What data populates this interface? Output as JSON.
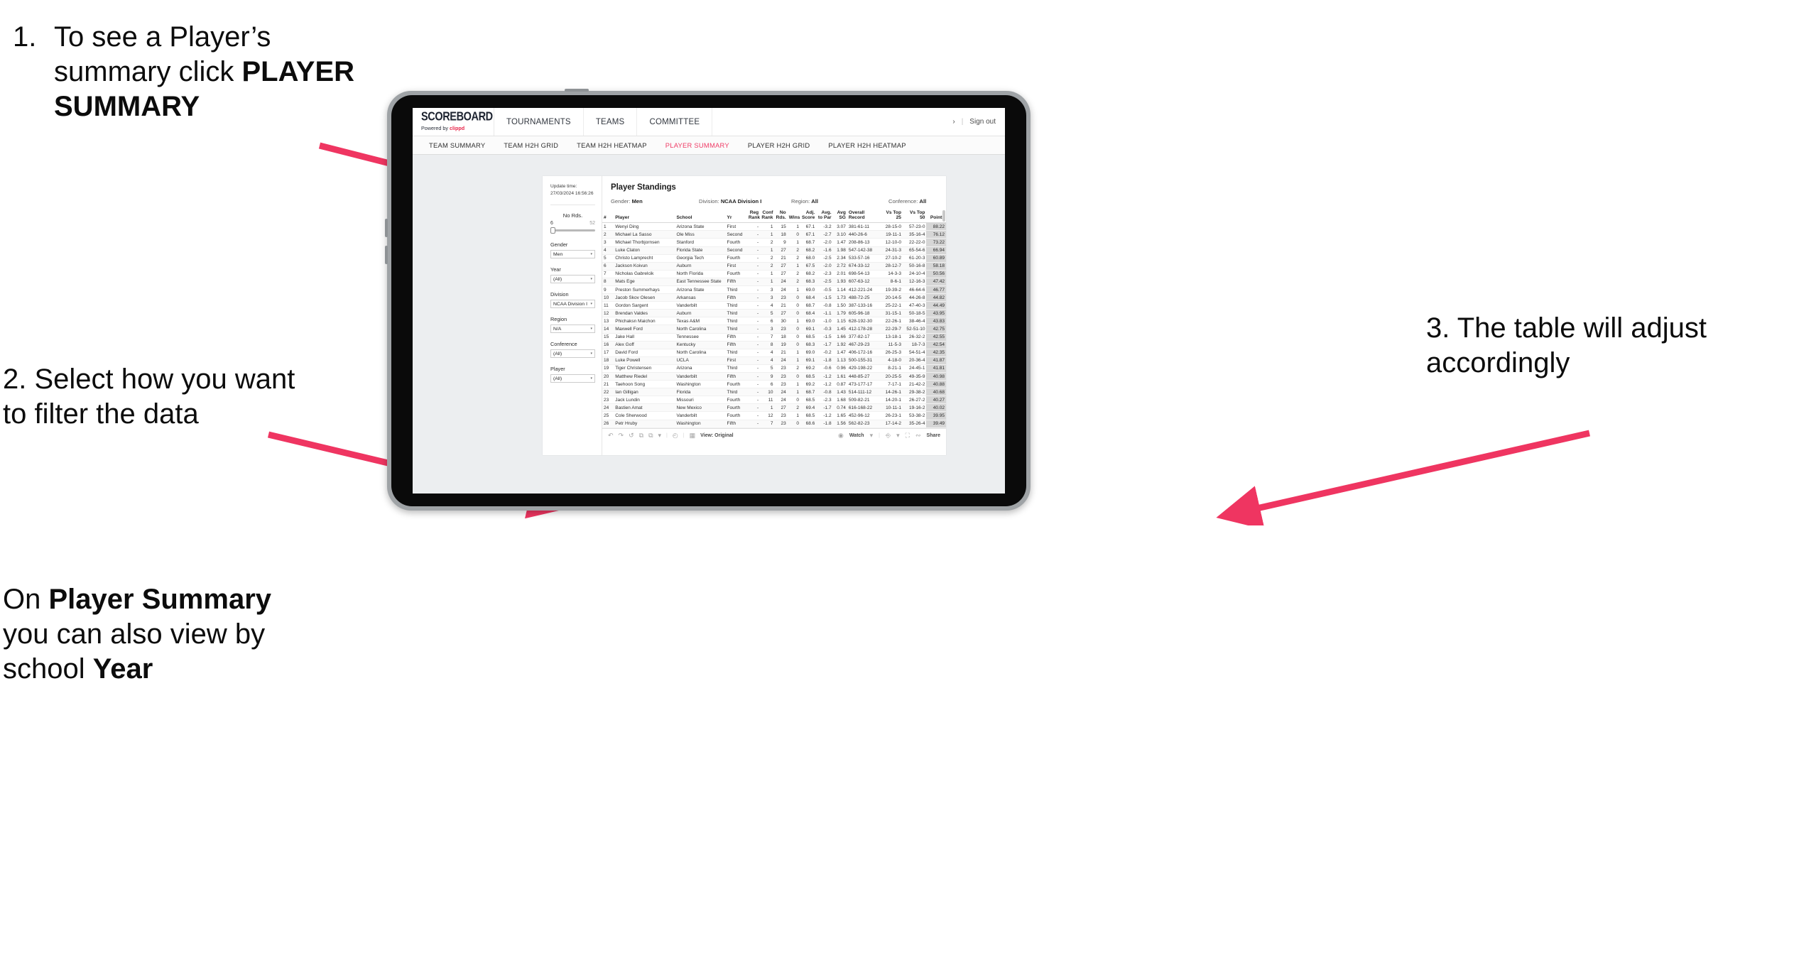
{
  "annotations": {
    "step1": {
      "number": "1.",
      "text_before": "To see a Player’s summary click ",
      "bold": "PLAYER SUMMARY"
    },
    "step2": {
      "number": "2.",
      "text": "Select how you want to filter the data"
    },
    "step2b": {
      "p1": "On ",
      "b1": "Player Summary",
      "p2": " you can also view by school ",
      "b2": "Year"
    },
    "step3": {
      "number": "3.",
      "text": "The table will adjust accordingly"
    }
  },
  "app": {
    "logo_main": "SCOREBOARD",
    "logo_sub_prefix": "Powered by ",
    "logo_sub_brand": "clippd",
    "main_nav": [
      "TOURNAMENTS",
      "TEAMS",
      "COMMITTEE"
    ],
    "account_glyph": "›",
    "sep": "|",
    "sign_out": "Sign out",
    "sub_nav": [
      "TEAM SUMMARY",
      "TEAM H2H GRID",
      "TEAM H2H HEATMAP",
      "PLAYER SUMMARY",
      "PLAYER H2H GRID",
      "PLAYER H2H HEATMAP"
    ],
    "sub_nav_active": "PLAYER SUMMARY",
    "accent_color": "#ef3c66"
  },
  "filters": {
    "update_label": "Update time:",
    "update_value": "27/03/2024 16:56:26",
    "slider": {
      "title": "No Rds.",
      "min": "6",
      "max": "52"
    },
    "selects": [
      {
        "label": "Gender",
        "value": "Men"
      },
      {
        "label": "Year",
        "value": "(All)"
      },
      {
        "label": "Division",
        "value": "NCAA Division I"
      },
      {
        "label": "Region",
        "value": "N/A"
      },
      {
        "label": "Conference",
        "value": "(All)"
      },
      {
        "label": "Player",
        "value": "(All)"
      }
    ]
  },
  "viz": {
    "title": "Player Standings",
    "meta": [
      {
        "label": "Gender: ",
        "value": "Men"
      },
      {
        "label": "Division: ",
        "value": "NCAA Division I"
      },
      {
        "label": "Region: ",
        "value": "All"
      },
      {
        "label": "Conference: ",
        "value": "All"
      }
    ]
  },
  "toolbar": {
    "undo": "↶",
    "redo": "↷",
    "revert": "↺",
    "refresh": "⧉",
    "pause": "⧉",
    "view_caret": "▾",
    "clock": "◴",
    "view_label": "View: Original",
    "watch_label": "Watch",
    "watch_caret": "▾",
    "download_caret": "▾",
    "fullscreen": "⛶",
    "share_label": "Share"
  },
  "table": {
    "columns": [
      "#",
      "Player",
      "School",
      "Yr",
      "Reg Rank",
      "Conf Rank",
      "No Rds.",
      "Wins",
      "Adj. Score",
      "Avg. to Par",
      "Avg SG",
      "Overall Record",
      "Vs Top 25",
      "Vs Top 50",
      "Points"
    ],
    "rows": [
      [
        "1",
        "Wenyi Ding",
        "Arizona State",
        "First",
        "-",
        "1",
        "15",
        "1",
        "67.1",
        "-3.2",
        "3.07",
        "381-61-11",
        "28-15-0",
        "57-23-0",
        "88.22"
      ],
      [
        "2",
        "Michael La Sasso",
        "Ole Miss",
        "Second",
        "-",
        "1",
        "18",
        "0",
        "67.1",
        "-2.7",
        "3.10",
        "440-26-6",
        "19-11-1",
        "35-16-4",
        "76.12"
      ],
      [
        "3",
        "Michael Thorbjornsen",
        "Stanford",
        "Fourth",
        "-",
        "2",
        "9",
        "1",
        "68.7",
        "-2.0",
        "1.47",
        "208-86-13",
        "12-10-0",
        "22-22-0",
        "73.22"
      ],
      [
        "4",
        "Luke Claton",
        "Florida State",
        "Second",
        "-",
        "1",
        "27",
        "2",
        "68.2",
        "-1.6",
        "1.98",
        "547-142-38",
        "24-31-3",
        "65-54-6",
        "66.94"
      ],
      [
        "5",
        "Christo Lamprecht",
        "Georgia Tech",
        "Fourth",
        "-",
        "2",
        "21",
        "2",
        "68.0",
        "-2.5",
        "2.34",
        "533-57-16",
        "27-10-2",
        "61-20-3",
        "60.89"
      ],
      [
        "6",
        "Jackson Koivun",
        "Auburn",
        "First",
        "-",
        "2",
        "27",
        "1",
        "67.5",
        "-2.0",
        "2.72",
        "674-33-12",
        "28-12-7",
        "50-16-8",
        "58.18"
      ],
      [
        "7",
        "Nicholas Gabrelcik",
        "North Florida",
        "Fourth",
        "-",
        "1",
        "27",
        "2",
        "68.2",
        "-2.3",
        "2.01",
        "698-54-13",
        "14-3-3",
        "24-10-4",
        "50.56"
      ],
      [
        "8",
        "Mats Ege",
        "East Tennessee State",
        "Fifth",
        "-",
        "1",
        "24",
        "2",
        "68.3",
        "-2.5",
        "1.93",
        "607-63-12",
        "8-6-1",
        "12-16-3",
        "47.42"
      ],
      [
        "9",
        "Preston Summerhays",
        "Arizona State",
        "Third",
        "-",
        "3",
        "24",
        "1",
        "69.0",
        "-0.5",
        "1.14",
        "412-221-24",
        "19-39-2",
        "46-64-6",
        "46.77"
      ],
      [
        "10",
        "Jacob Skov Olesen",
        "Arkansas",
        "Fifth",
        "-",
        "3",
        "23",
        "0",
        "68.4",
        "-1.5",
        "1.73",
        "488-72-25",
        "20-14-5",
        "44-26-8",
        "44.82"
      ],
      [
        "11",
        "Gordon Sargent",
        "Vanderbilt",
        "Third",
        "-",
        "4",
        "21",
        "0",
        "68.7",
        "-0.8",
        "1.50",
        "387-133-16",
        "25-22-1",
        "47-40-3",
        "44.49"
      ],
      [
        "12",
        "Brendan Valdes",
        "Auburn",
        "Third",
        "-",
        "5",
        "27",
        "0",
        "68.4",
        "-1.1",
        "1.79",
        "605-96-18",
        "31-15-1",
        "50-18-5",
        "43.95"
      ],
      [
        "13",
        "Phichaksn Maichon",
        "Texas A&M",
        "Third",
        "-",
        "6",
        "30",
        "1",
        "69.0",
        "-1.0",
        "1.15",
        "628-192-30",
        "22-26-1",
        "38-46-4",
        "43.83"
      ],
      [
        "14",
        "Maxwell Ford",
        "North Carolina",
        "Third",
        "-",
        "3",
        "23",
        "0",
        "69.1",
        "-0.3",
        "1.45",
        "412-178-28",
        "22-29-7",
        "52-51-10",
        "42.75"
      ],
      [
        "15",
        "Jake Hall",
        "Tennessee",
        "Fifth",
        "-",
        "7",
        "18",
        "0",
        "68.5",
        "-1.5",
        "1.66",
        "377-82-17",
        "13-18-1",
        "26-32-2",
        "42.55"
      ],
      [
        "16",
        "Alex Goff",
        "Kentucky",
        "Fifth",
        "-",
        "8",
        "19",
        "0",
        "68.3",
        "-1.7",
        "1.92",
        "467-29-23",
        "11-5-3",
        "18-7-3",
        "42.54"
      ],
      [
        "17",
        "David Ford",
        "North Carolina",
        "Third",
        "-",
        "4",
        "21",
        "1",
        "69.0",
        "-0.2",
        "1.47",
        "406-172-16",
        "26-25-3",
        "54-51-4",
        "42.35"
      ],
      [
        "18",
        "Luke Powell",
        "UCLA",
        "First",
        "-",
        "4",
        "24",
        "1",
        "69.1",
        "-1.8",
        "1.13",
        "500-155-31",
        "4-18-0",
        "20-36-4",
        "41.87"
      ],
      [
        "19",
        "Tiger Christensen",
        "Arizona",
        "Third",
        "-",
        "5",
        "23",
        "2",
        "69.2",
        "-0.6",
        "0.96",
        "429-198-22",
        "8-21-1",
        "24-45-1",
        "41.81"
      ],
      [
        "20",
        "Matthew Riedel",
        "Vanderbilt",
        "Fifth",
        "-",
        "9",
        "23",
        "0",
        "68.5",
        "-1.2",
        "1.61",
        "448-85-27",
        "20-25-5",
        "49-35-9",
        "40.98"
      ],
      [
        "21",
        "Taehoon Song",
        "Washington",
        "Fourth",
        "-",
        "6",
        "23",
        "1",
        "69.2",
        "-1.2",
        "0.87",
        "473-177-17",
        "7-17-1",
        "21-42-2",
        "40.88"
      ],
      [
        "22",
        "Ian Gilligan",
        "Florida",
        "Third",
        "-",
        "10",
        "24",
        "1",
        "68.7",
        "-0.8",
        "1.43",
        "514-111-12",
        "14-26-1",
        "29-38-2",
        "40.68"
      ],
      [
        "23",
        "Jack Lundin",
        "Missouri",
        "Fourth",
        "-",
        "11",
        "24",
        "0",
        "68.5",
        "-2.3",
        "1.68",
        "509-82-21",
        "14-20-1",
        "26-27-2",
        "40.27"
      ],
      [
        "24",
        "Bastien Amat",
        "New Mexico",
        "Fourth",
        "-",
        "1",
        "27",
        "2",
        "69.4",
        "-1.7",
        "0.74",
        "616-168-22",
        "10-11-1",
        "19-16-2",
        "40.02"
      ],
      [
        "25",
        "Cole Sherwood",
        "Vanderbilt",
        "Fourth",
        "-",
        "12",
        "23",
        "1",
        "68.5",
        "-1.2",
        "1.65",
        "452-96-12",
        "26-23-1",
        "53-38-2",
        "39.95"
      ],
      [
        "26",
        "Petr Hruby",
        "Washington",
        "Fifth",
        "-",
        "7",
        "23",
        "0",
        "68.6",
        "-1.8",
        "1.56",
        "562-82-23",
        "17-14-2",
        "35-26-4",
        "39.49"
      ]
    ]
  }
}
